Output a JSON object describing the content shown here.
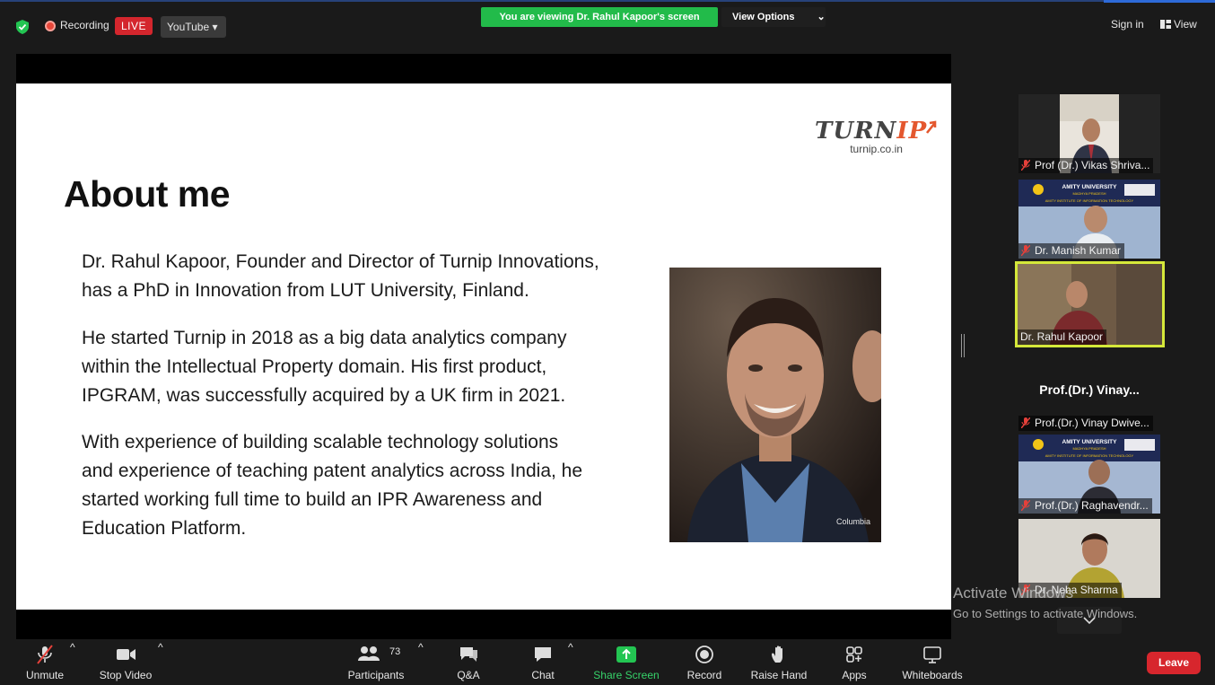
{
  "topbar": {
    "recording_label": "Recording",
    "live_badge": "LIVE",
    "youtube_label": "YouTube ▾",
    "viewing_banner": "You are viewing Dr. Rahul Kapoor's screen",
    "view_options": "View Options",
    "view_options_caret": "⌄",
    "sign_in": "Sign in",
    "view": "View"
  },
  "slide": {
    "title": "About me",
    "logo_main_a": "TURN",
    "logo_main_b": "IP",
    "logo_sub": "turnip.co.in",
    "para1_line1": "Dr. Rahul Kapoor, Founder and Director of Turnip Innovations,",
    "para1_line2": "has a PhD in Innovation from LUT University, Finland.",
    "para2_line1": "He started Turnip in 2018 as a big data analytics company",
    "para2_line2": "within the Intellectual Property domain. His first product,",
    "para2_line3": "IPGRAM, was successfully acquired by a UK firm in 2021.",
    "para3_line1": "With experience of building scalable technology solutions",
    "para3_line2": "and experience of teaching patent analytics across India, he",
    "para3_line3": "started working full time to build an IPR Awareness and",
    "para3_line4": "Education Platform.",
    "photo_brand": "Columbia"
  },
  "gallery": {
    "tiles": [
      {
        "name": "Prof (Dr.) Vikas Shriva..."
      },
      {
        "name": "Dr. Manish Kumar",
        "banner_title": "AMITY UNIVERSITY",
        "banner_sub": "MADHYA PRADESH",
        "banner_line": "AMITY INSTITUTE OF INFORMATION TECHNOLOGY"
      },
      {
        "name": "Dr. Rahul Kapoor"
      },
      {
        "name": "Prof.(Dr.) Vinay Dwive...",
        "big_name": "Prof.(Dr.)  Vinay..."
      },
      {
        "name": "Prof.(Dr.) Raghavendr...",
        "banner_title": "AMITY UNIVERSITY",
        "banner_sub": "MADHYA PRADESH",
        "banner_line": "AMITY INSTITUTE OF INFORMATION TECHNOLOGY"
      },
      {
        "name": "Dr. Neha Sharma"
      }
    ]
  },
  "watermark": {
    "line1": "Activate Windows",
    "line2": "Go to Settings to activate Windows."
  },
  "toolbar": {
    "unmute": "Unmute",
    "stop_video": "Stop Video",
    "participants": "Participants",
    "participants_count": "73",
    "qa": "Q&A",
    "chat": "Chat",
    "share_screen": "Share Screen",
    "record": "Record",
    "raise_hand": "Raise Hand",
    "apps": "Apps",
    "whiteboards": "Whiteboards",
    "leave": "Leave",
    "caret": "^"
  },
  "colors": {
    "live_red": "#d4262d",
    "banner_green": "#22bb4a",
    "share_green": "#36d36a",
    "active_speaker": "#d5e83a",
    "leave_red": "#d7262d"
  }
}
